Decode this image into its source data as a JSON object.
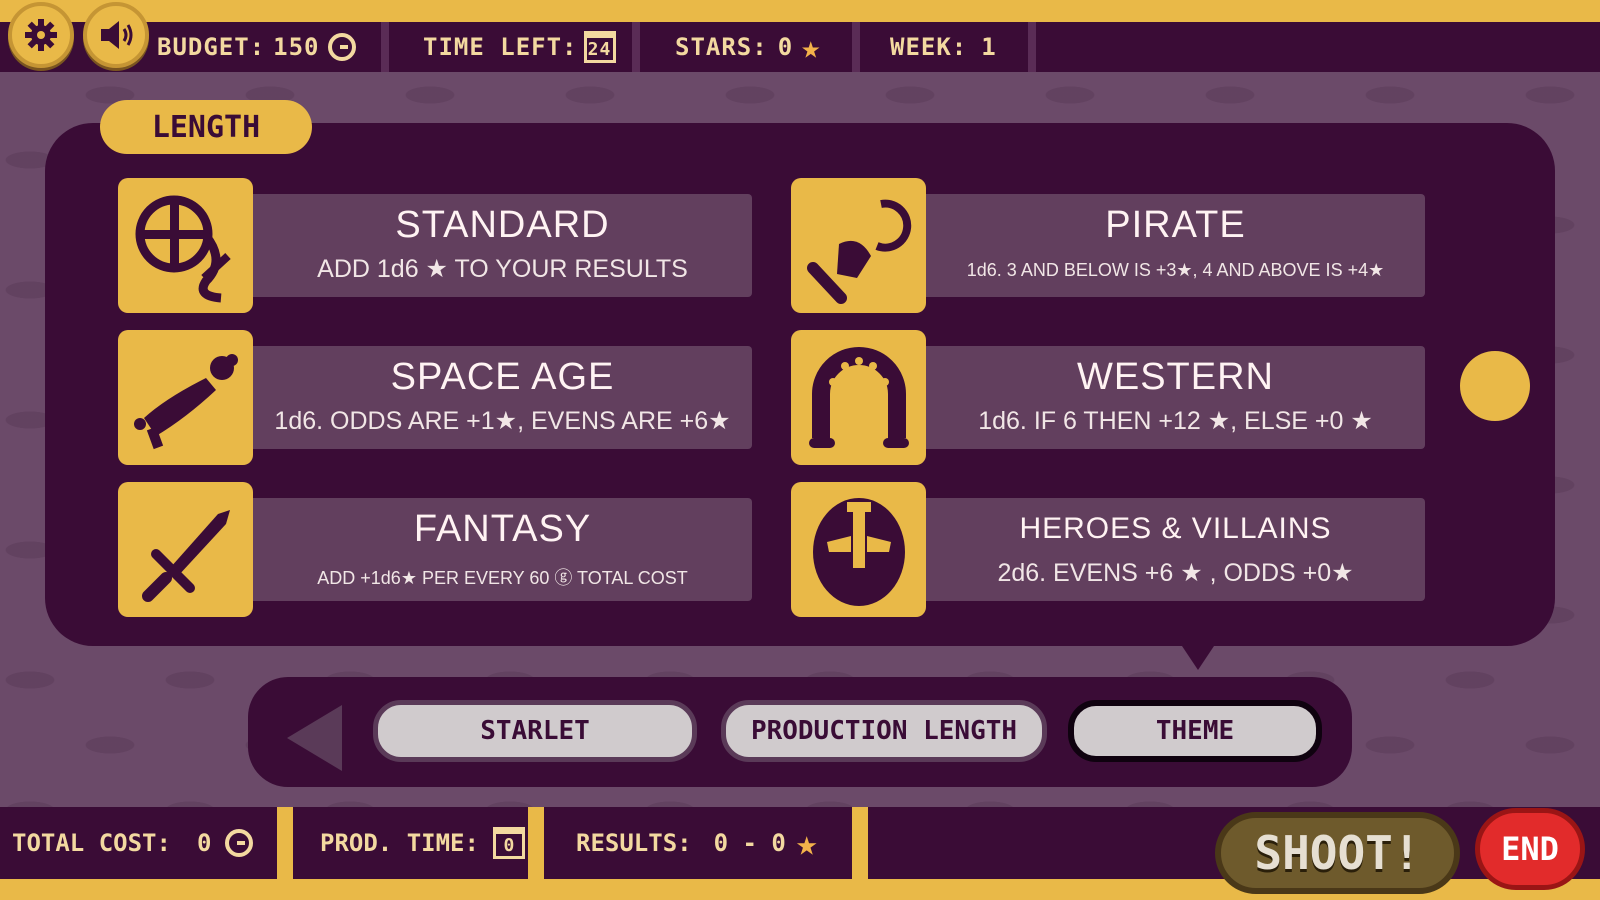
{
  "top_bar": {
    "settings_icon": "gear-icon",
    "sound_icon": "speaker-icon",
    "budget_label": "BUDGET:",
    "budget_value": "150",
    "time_left_label": "TIME LEFT:",
    "time_left_value": "24",
    "stars_label": "STARS:",
    "stars_value": "0",
    "week_label": "WEEK:",
    "week_value": "1"
  },
  "panel": {
    "tab_label": "LENGTH",
    "options": [
      {
        "title": "STANDARD",
        "desc": "ADD 1d6 ★ TO YOUR RESULTS",
        "icon": "film-reel-icon"
      },
      {
        "title": "PIRATE",
        "desc": "1d6. 3 AND BELOW IS +3★, 4 AND ABOVE IS +4★",
        "icon": "pirate-hook-icon"
      },
      {
        "title": "SPACE AGE",
        "desc": "1d6. ODDS ARE +1★, EVENS ARE +6★",
        "icon": "ray-gun-icon"
      },
      {
        "title": "WESTERN",
        "desc": "1d6. IF 6 THEN +12 ★, ELSE +0 ★",
        "icon": "horseshoe-icon"
      },
      {
        "title": "FANTASY",
        "desc": "ADD +1d6★ PER EVERY 60 ⓖ TOTAL COST",
        "icon": "sword-icon"
      },
      {
        "title": "HEROES & VILLAINS",
        "desc": "2d6. EVENS +6 ★ , ODDS +0★",
        "icon": "hero-mask-icon"
      }
    ]
  },
  "nav": {
    "back_icon": "back-arrow-icon",
    "buttons": [
      "STARLET",
      "PRODUCTION LENGTH",
      "THEME"
    ],
    "active": "THEME"
  },
  "bottom_bar": {
    "total_cost_label": "TOTAL COST:",
    "total_cost_value": "0",
    "prod_time_label": "PROD. TIME:",
    "prod_time_value": "0",
    "results_label": "RESULTS:",
    "results_value": "0 - 0",
    "shoot_label": "SHOOT!",
    "end_label": "END"
  },
  "colors": {
    "background": "#6b4a69",
    "panel": "#3a0c36",
    "accent": "#e9b948",
    "card": "#623f5e",
    "end_button": "#e22b2b"
  }
}
